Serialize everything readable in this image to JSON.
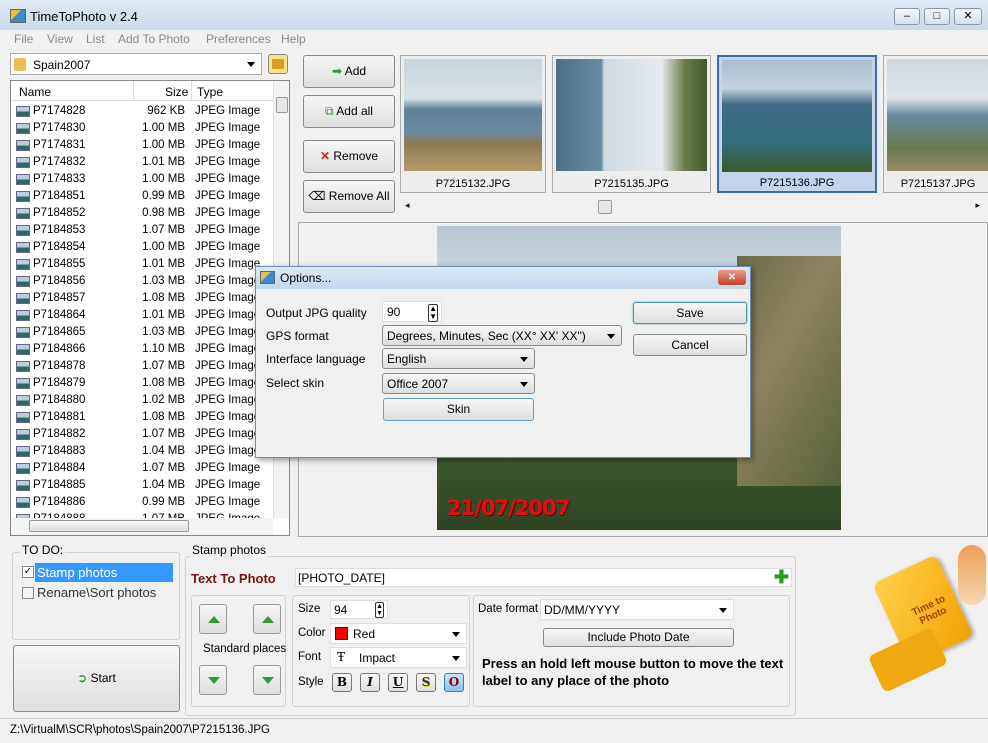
{
  "window": {
    "title": "TimeToPhoto v 2.4",
    "controls": [
      "minimize",
      "maximize",
      "close"
    ]
  },
  "menu": [
    "File",
    "View",
    "List",
    "Add To Photo",
    "Preferences",
    "Help"
  ],
  "folder": {
    "value": "Spain2007"
  },
  "file_list": {
    "headers": [
      "Name",
      "Size",
      "Type"
    ],
    "rows": [
      [
        "P7174828",
        "962 KB",
        "JPEG Image"
      ],
      [
        "P7174830",
        "1.00 MB",
        "JPEG Image"
      ],
      [
        "P7174831",
        "1.00 MB",
        "JPEG Image"
      ],
      [
        "P7174832",
        "1.01 MB",
        "JPEG Image"
      ],
      [
        "P7174833",
        "1.00 MB",
        "JPEG Image"
      ],
      [
        "P7184851",
        "0.99 MB",
        "JPEG Image"
      ],
      [
        "P7184852",
        "0.98 MB",
        "JPEG Image"
      ],
      [
        "P7184853",
        "1.07 MB",
        "JPEG Image"
      ],
      [
        "P7184854",
        "1.00 MB",
        "JPEG Image"
      ],
      [
        "P7184855",
        "1.01 MB",
        "JPEG Image"
      ],
      [
        "P7184856",
        "1.03 MB",
        "JPEG Image"
      ],
      [
        "P7184857",
        "1.08 MB",
        "JPEG Image"
      ],
      [
        "P7184864",
        "1.01 MB",
        "JPEG Image"
      ],
      [
        "P7184865",
        "1.03 MB",
        "JPEG Image"
      ],
      [
        "P7184866",
        "1.10 MB",
        "JPEG Image"
      ],
      [
        "P7184878",
        "1.07 MB",
        "JPEG Image"
      ],
      [
        "P7184879",
        "1.08 MB",
        "JPEG Image"
      ],
      [
        "P7184880",
        "1.02 MB",
        "JPEG Image"
      ],
      [
        "P7184881",
        "1.08 MB",
        "JPEG Image"
      ],
      [
        "P7184882",
        "1.07 MB",
        "JPEG Image"
      ],
      [
        "P7184883",
        "1.04 MB",
        "JPEG Image"
      ],
      [
        "P7184884",
        "1.07 MB",
        "JPEG Image"
      ],
      [
        "P7184885",
        "1.04 MB",
        "JPEG Image"
      ],
      [
        "P7184886",
        "0.99 MB",
        "JPEG Image"
      ],
      [
        "P7184888",
        "1.07 MB",
        "JPEG Image"
      ]
    ]
  },
  "actions": {
    "add": "Add",
    "add_all": "Add all",
    "remove": "Remove",
    "remove_all": "Remove All"
  },
  "thumbnails": [
    {
      "name": "P7215132.JPG"
    },
    {
      "name": "P7215135.JPG"
    },
    {
      "name": "P7215136.JPG",
      "selected": true
    },
    {
      "name": "P7215137.JPG"
    }
  ],
  "preview": {
    "stamp_text": "21/07/2007",
    "stamp_color": "#e01010"
  },
  "options_dialog": {
    "title": "Options...",
    "fields": [
      {
        "label": "Output JPG quality",
        "value": "90"
      },
      {
        "label": "GPS format",
        "value": "Degrees, Minutes, Sec (XX° XX' XX\")"
      },
      {
        "label": "Interface language",
        "value": "English"
      },
      {
        "label": "Select skin",
        "value": "Office 2007"
      }
    ],
    "skin_button": "Skin",
    "save": "Save",
    "cancel": "Cancel"
  },
  "todo": {
    "title": "TO DO:",
    "items": [
      {
        "label": "Stamp photos",
        "checked": true,
        "selected": true
      },
      {
        "label": "Rename\\Sort photos",
        "checked": false
      }
    ],
    "start": "Start"
  },
  "stamp": {
    "title": "Stamp photos",
    "text_label": "Text To Photo",
    "text_value": "[PHOTO_DATE]",
    "standard_places": "Standard places",
    "size_label": "Size",
    "size": "94",
    "color_label": "Color",
    "color": "Red",
    "color_hex": "#ff0000",
    "font_label": "Font",
    "font": "Impact",
    "style_label": "Style",
    "styles": [
      "B",
      "I",
      "U",
      "S",
      "O"
    ],
    "date_format_label": "Date format",
    "date_format": "DD/MM/YYYY",
    "include_date": "Include Photo Date",
    "hint": "Press an hold left mouse button to move the text label to any place of the photo"
  },
  "logo": {
    "text": "Time to Photo"
  },
  "status": {
    "path": "Z:\\VirtualM\\SCR\\photos\\Spain2007\\P7215136.JPG"
  }
}
